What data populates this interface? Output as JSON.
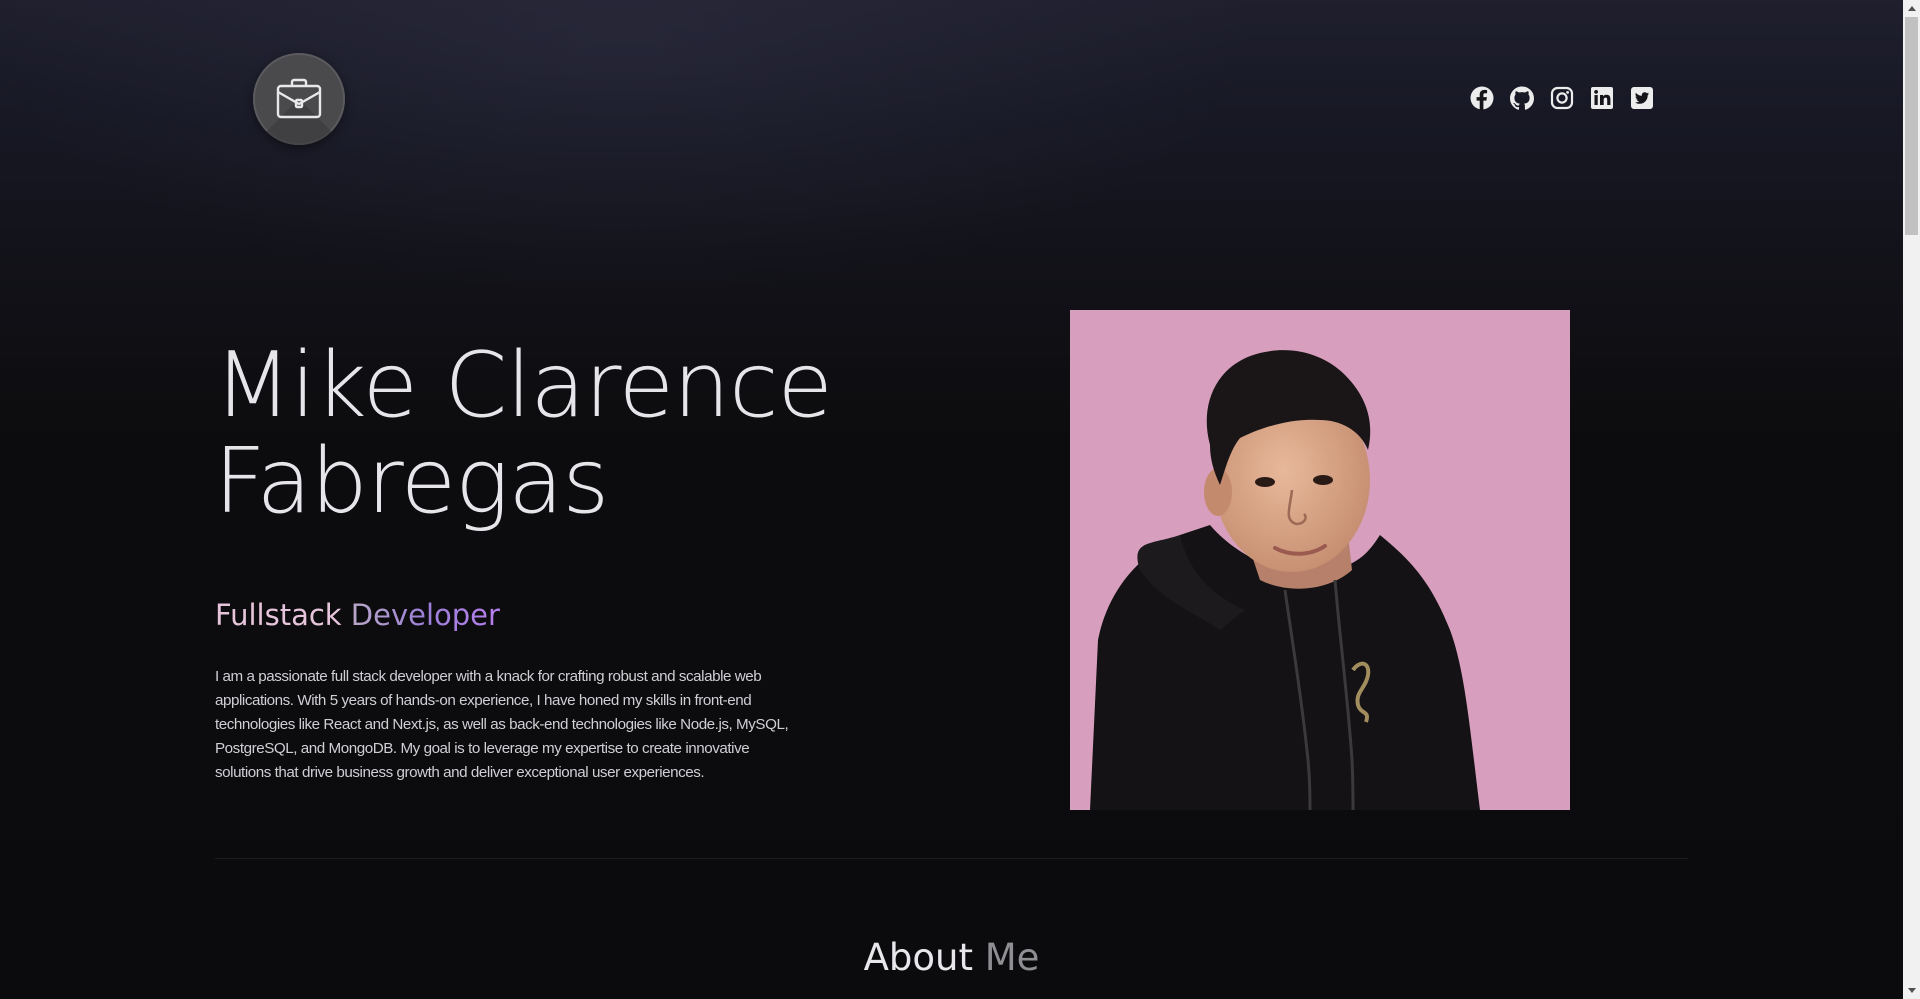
{
  "header": {
    "logo_icon": "briefcase-icon",
    "socials": [
      {
        "name": "Facebook",
        "icon": "facebook-icon"
      },
      {
        "name": "GitHub",
        "icon": "github-icon"
      },
      {
        "name": "Instagram",
        "icon": "instagram-icon"
      },
      {
        "name": "LinkedIn",
        "icon": "linkedin-icon"
      },
      {
        "name": "Twitter",
        "icon": "twitter-icon"
      }
    ]
  },
  "hero": {
    "name_line1": "Mike Clarence",
    "name_line2": "Fabregas",
    "role_word1": "Fullstack",
    "role_word2": "Developer",
    "bio": "I am a passionate full stack developer with a knack for crafting robust and scalable web applications. With 5 years of hands-on experience, I have honed my skills in front-end technologies like React and Next.js, as well as back-end technologies like Node.js, MySQL, PostgreSQL, and MongoDB. My goal is to leverage my expertise to create innovative solutions that drive business growth and deliver exceptional user experiences.",
    "photo_background_color": "#d79fbd"
  },
  "about": {
    "title_word1": "About",
    "title_word2": "Me"
  },
  "colors": {
    "background": "#0b0b0d",
    "accent_pink": "#e6c4db",
    "accent_purple": "#b77ff0"
  },
  "scroll_position": 0
}
